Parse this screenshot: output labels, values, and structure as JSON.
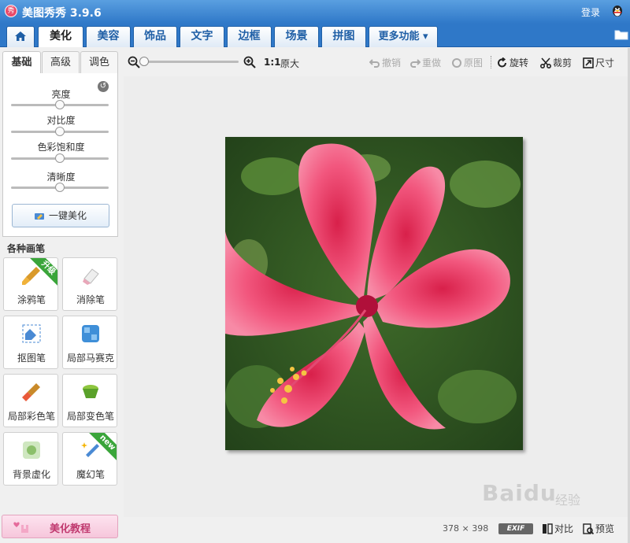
{
  "app": {
    "title": "美图秀秀 3.9.6",
    "icon_text": "秀",
    "login": "登录"
  },
  "tabs": [
    {
      "label": "美化",
      "active": true
    },
    {
      "label": "美容"
    },
    {
      "label": "饰品"
    },
    {
      "label": "文字"
    },
    {
      "label": "边框"
    },
    {
      "label": "场景"
    },
    {
      "label": "拼图"
    },
    {
      "label": "更多功能 ▾"
    }
  ],
  "subtabs": [
    "基础",
    "高级",
    "调色"
  ],
  "adjust": {
    "sliders": [
      {
        "label": "亮度",
        "value": 0.5
      },
      {
        "label": "对比度",
        "value": 0.5
      },
      {
        "label": "色彩饱和度",
        "value": 0.5
      },
      {
        "label": "清晰度",
        "value": 0.5
      }
    ],
    "onekey_label": "一键美化"
  },
  "brushes": {
    "title": "各种画笔",
    "items": [
      {
        "label": "涂鸦笔",
        "ribbon": "升级"
      },
      {
        "label": "消除笔"
      },
      {
        "label": "抠图笔"
      },
      {
        "label": "局部马赛克"
      },
      {
        "label": "局部彩色笔"
      },
      {
        "label": "局部变色笔"
      },
      {
        "label": "背景虚化"
      },
      {
        "label": "魔幻笔",
        "ribbon": "new"
      }
    ]
  },
  "tutorial_label": "美化教程",
  "toolbar": {
    "zoom_value": 0.0,
    "one_to_one": "1:1",
    "original_size": "原大",
    "undo": "撤销",
    "redo": "重做",
    "original": "原图",
    "rotate": "旋转",
    "crop": "裁剪",
    "size": "尺寸"
  },
  "status": {
    "width": "378",
    "times": "×",
    "height": "398",
    "exif": "EXIF",
    "compare": "对比",
    "preview": "预览"
  },
  "watermark": {
    "main": "Baidu",
    "sub": "经验"
  }
}
